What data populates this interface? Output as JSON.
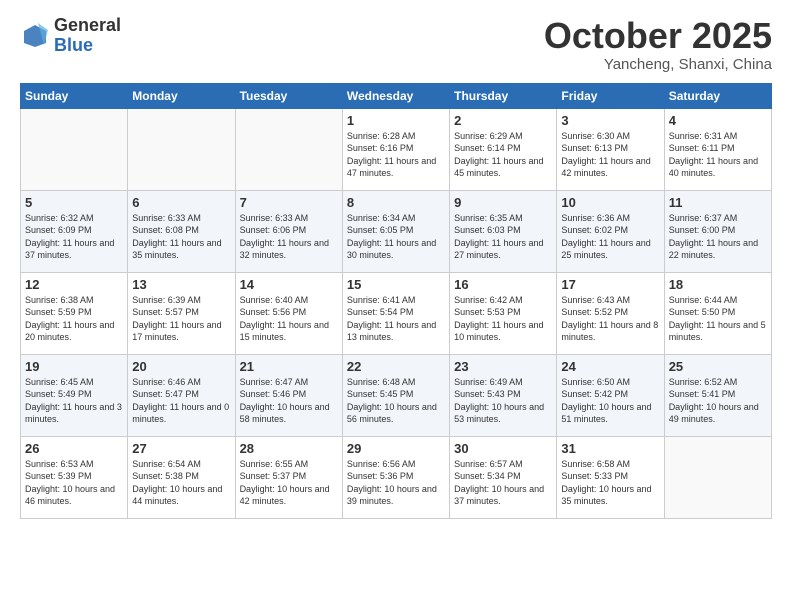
{
  "logo": {
    "general": "General",
    "blue": "Blue"
  },
  "title": "October 2025",
  "location": "Yancheng, Shanxi, China",
  "headers": [
    "Sunday",
    "Monday",
    "Tuesday",
    "Wednesday",
    "Thursday",
    "Friday",
    "Saturday"
  ],
  "weeks": [
    [
      {
        "day": "",
        "info": ""
      },
      {
        "day": "",
        "info": ""
      },
      {
        "day": "",
        "info": ""
      },
      {
        "day": "1",
        "info": "Sunrise: 6:28 AM\nSunset: 6:16 PM\nDaylight: 11 hours\nand 47 minutes."
      },
      {
        "day": "2",
        "info": "Sunrise: 6:29 AM\nSunset: 6:14 PM\nDaylight: 11 hours\nand 45 minutes."
      },
      {
        "day": "3",
        "info": "Sunrise: 6:30 AM\nSunset: 6:13 PM\nDaylight: 11 hours\nand 42 minutes."
      },
      {
        "day": "4",
        "info": "Sunrise: 6:31 AM\nSunset: 6:11 PM\nDaylight: 11 hours\nand 40 minutes."
      }
    ],
    [
      {
        "day": "5",
        "info": "Sunrise: 6:32 AM\nSunset: 6:09 PM\nDaylight: 11 hours\nand 37 minutes."
      },
      {
        "day": "6",
        "info": "Sunrise: 6:33 AM\nSunset: 6:08 PM\nDaylight: 11 hours\nand 35 minutes."
      },
      {
        "day": "7",
        "info": "Sunrise: 6:33 AM\nSunset: 6:06 PM\nDaylight: 11 hours\nand 32 minutes."
      },
      {
        "day": "8",
        "info": "Sunrise: 6:34 AM\nSunset: 6:05 PM\nDaylight: 11 hours\nand 30 minutes."
      },
      {
        "day": "9",
        "info": "Sunrise: 6:35 AM\nSunset: 6:03 PM\nDaylight: 11 hours\nand 27 minutes."
      },
      {
        "day": "10",
        "info": "Sunrise: 6:36 AM\nSunset: 6:02 PM\nDaylight: 11 hours\nand 25 minutes."
      },
      {
        "day": "11",
        "info": "Sunrise: 6:37 AM\nSunset: 6:00 PM\nDaylight: 11 hours\nand 22 minutes."
      }
    ],
    [
      {
        "day": "12",
        "info": "Sunrise: 6:38 AM\nSunset: 5:59 PM\nDaylight: 11 hours\nand 20 minutes."
      },
      {
        "day": "13",
        "info": "Sunrise: 6:39 AM\nSunset: 5:57 PM\nDaylight: 11 hours\nand 17 minutes."
      },
      {
        "day": "14",
        "info": "Sunrise: 6:40 AM\nSunset: 5:56 PM\nDaylight: 11 hours\nand 15 minutes."
      },
      {
        "day": "15",
        "info": "Sunrise: 6:41 AM\nSunset: 5:54 PM\nDaylight: 11 hours\nand 13 minutes."
      },
      {
        "day": "16",
        "info": "Sunrise: 6:42 AM\nSunset: 5:53 PM\nDaylight: 11 hours\nand 10 minutes."
      },
      {
        "day": "17",
        "info": "Sunrise: 6:43 AM\nSunset: 5:52 PM\nDaylight: 11 hours\nand 8 minutes."
      },
      {
        "day": "18",
        "info": "Sunrise: 6:44 AM\nSunset: 5:50 PM\nDaylight: 11 hours\nand 5 minutes."
      }
    ],
    [
      {
        "day": "19",
        "info": "Sunrise: 6:45 AM\nSunset: 5:49 PM\nDaylight: 11 hours\nand 3 minutes."
      },
      {
        "day": "20",
        "info": "Sunrise: 6:46 AM\nSunset: 5:47 PM\nDaylight: 11 hours\nand 0 minutes."
      },
      {
        "day": "21",
        "info": "Sunrise: 6:47 AM\nSunset: 5:46 PM\nDaylight: 10 hours\nand 58 minutes."
      },
      {
        "day": "22",
        "info": "Sunrise: 6:48 AM\nSunset: 5:45 PM\nDaylight: 10 hours\nand 56 minutes."
      },
      {
        "day": "23",
        "info": "Sunrise: 6:49 AM\nSunset: 5:43 PM\nDaylight: 10 hours\nand 53 minutes."
      },
      {
        "day": "24",
        "info": "Sunrise: 6:50 AM\nSunset: 5:42 PM\nDaylight: 10 hours\nand 51 minutes."
      },
      {
        "day": "25",
        "info": "Sunrise: 6:52 AM\nSunset: 5:41 PM\nDaylight: 10 hours\nand 49 minutes."
      }
    ],
    [
      {
        "day": "26",
        "info": "Sunrise: 6:53 AM\nSunset: 5:39 PM\nDaylight: 10 hours\nand 46 minutes."
      },
      {
        "day": "27",
        "info": "Sunrise: 6:54 AM\nSunset: 5:38 PM\nDaylight: 10 hours\nand 44 minutes."
      },
      {
        "day": "28",
        "info": "Sunrise: 6:55 AM\nSunset: 5:37 PM\nDaylight: 10 hours\nand 42 minutes."
      },
      {
        "day": "29",
        "info": "Sunrise: 6:56 AM\nSunset: 5:36 PM\nDaylight: 10 hours\nand 39 minutes."
      },
      {
        "day": "30",
        "info": "Sunrise: 6:57 AM\nSunset: 5:34 PM\nDaylight: 10 hours\nand 37 minutes."
      },
      {
        "day": "31",
        "info": "Sunrise: 6:58 AM\nSunset: 5:33 PM\nDaylight: 10 hours\nand 35 minutes."
      },
      {
        "day": "",
        "info": ""
      }
    ]
  ]
}
